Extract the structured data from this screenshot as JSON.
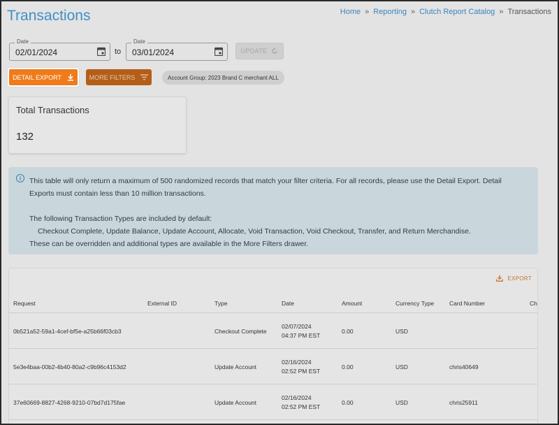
{
  "page": {
    "title": "Transactions"
  },
  "breadcrumb": {
    "items": [
      "Home",
      "Reporting",
      "Clutch Report Catalog",
      "Transactions"
    ]
  },
  "filters": {
    "date_label": "Date",
    "start_date": "02/01/2024",
    "end_date": "03/01/2024",
    "to_label": "to",
    "update_label": "UPDATE",
    "detail_export_label": "DETAIL EXPORT",
    "more_filters_label": "MORE FILTERS",
    "account_group_chip": "Account Group: 2023 Brand C merchant ALL"
  },
  "summary": {
    "label": "Total Transactions",
    "value": "132"
  },
  "info": {
    "line1": "This table will only return a maximum of 500 randomized records that match your filter criteria. For all records, please use the Detail Export. Detail Exports must contain less than 10 million transactions.",
    "line2": "The following Transaction Types are included by default:",
    "line3": "Checkout Complete, Update Balance, Update Account, Allocate, Void Transaction, Void Checkout, Transfer, and Return Merchandise.",
    "line4": "These can be overridden and additional types are available in the More Filters drawer."
  },
  "table": {
    "export_label": "EXPORT",
    "columns": [
      "Request",
      "External ID",
      "Type",
      "Date",
      "Amount",
      "Currency Type",
      "Card Number",
      "Chi"
    ],
    "rows": [
      {
        "request": "0b521a52-59a1-4cef-bf5e-a25b66f03cb3",
        "external_id": "",
        "type": "Checkout Complete",
        "date": "02/07/2024",
        "time": "04:37 PM EST",
        "amount": "0.00",
        "currency": "USD",
        "card": ""
      },
      {
        "request": "5e3e4baa-00b2-4b40-80a2-c9b96c4153d2",
        "external_id": "",
        "type": "Update Account",
        "date": "02/16/2024",
        "time": "02:52 PM EST",
        "amount": "0.00",
        "currency": "USD",
        "card": "chris40649"
      },
      {
        "request": "37e60669-8827-4268-9210-07bd7d175fae",
        "external_id": "",
        "type": "Update Account",
        "date": "02/16/2024",
        "time": "02:52 PM EST",
        "amount": "0.00",
        "currency": "USD",
        "card": "chris25911"
      }
    ]
  },
  "colors": {
    "accent": "#ef7b1a",
    "title_blue": "#3f8fc8",
    "info_bg": "#c9d7dd"
  }
}
